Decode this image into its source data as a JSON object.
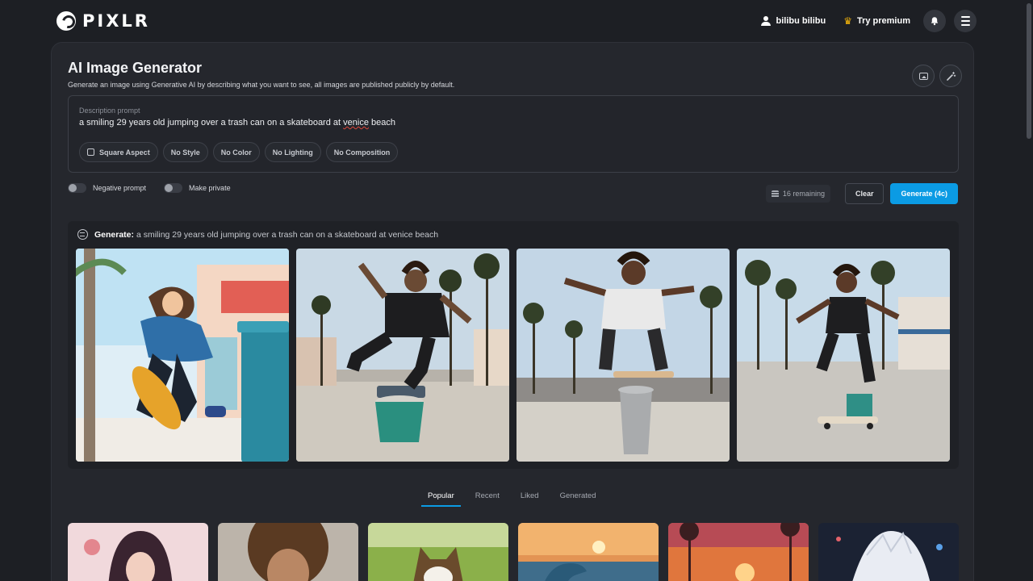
{
  "brand": {
    "name": "PIXLR"
  },
  "header": {
    "user_name": "bilibu bilibu",
    "premium_label": "Try premium"
  },
  "page": {
    "title": "AI Image Generator",
    "subtitle": "Generate an image using Generative AI by describing what you want to see, all images are published publicly by default."
  },
  "prompt": {
    "label": "Description prompt",
    "text_before": "a smiling 29 years old jumping over a trash can on a skateboard at ",
    "text_misspelled": "venice",
    "text_after": " beach"
  },
  "options": [
    {
      "label": "Square Aspect"
    },
    {
      "label": "No Style"
    },
    {
      "label": "No Color"
    },
    {
      "label": "No Lighting"
    },
    {
      "label": "No Composition"
    }
  ],
  "toggles": {
    "negative_prompt": "Negative prompt",
    "make_private": "Make private"
  },
  "actions": {
    "remaining": "16 remaining",
    "clear": "Clear",
    "generate": "Generate (4c)"
  },
  "result": {
    "heading": "Generate:",
    "prompt": "a smiling 29 years old jumping over a trash can on a skateboard at venice beach"
  },
  "tabs": [
    {
      "label": "Popular",
      "active": true
    },
    {
      "label": "Recent",
      "active": false
    },
    {
      "label": "Liked",
      "active": false
    },
    {
      "label": "Generated",
      "active": false
    }
  ],
  "colors": {
    "accent": "#0b9be4",
    "background": "#1d1f24",
    "card": "#25272d",
    "premium": "#f5b50a"
  }
}
